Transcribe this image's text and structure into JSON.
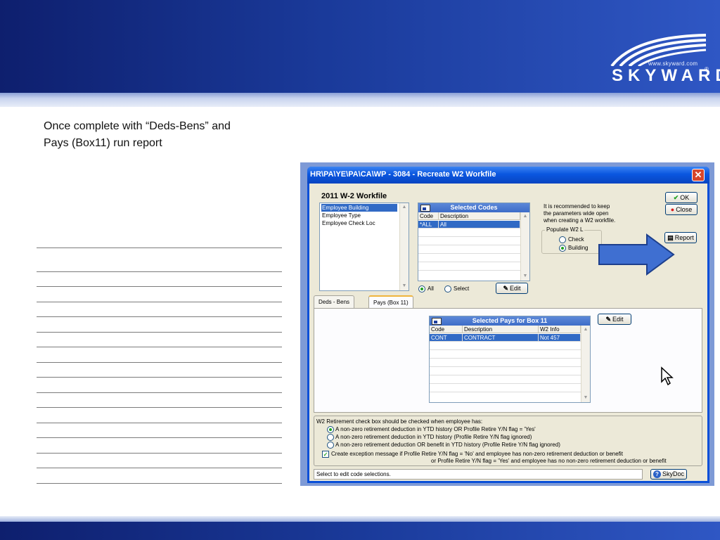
{
  "header": {
    "logo_url": "www.skyward.com",
    "logo_text": "SKYWARD",
    "logo_reg": "®"
  },
  "slide": {
    "text_line1": "Once complete with “Deds-Bens”  and",
    "text_line2": "Pays (Box11) run report"
  },
  "window": {
    "title": "HR\\PA\\YE\\PA\\CA\\WP - 3084 - Recreate W2 Workfile",
    "close_glyph": "✕",
    "workfile_title": "2011 W-2 Workfile",
    "list_items": [
      "Employee Building",
      "Employee Type",
      "Employee Check Loc"
    ],
    "selected_codes": {
      "header": "Selected Codes",
      "columns": [
        "Code",
        "Description"
      ],
      "rows": [
        [
          "*ALL",
          "All"
        ]
      ]
    },
    "radio_all": "All",
    "radio_select": "Select",
    "edit_label": "Edit",
    "note_line1": "It is recommended to keep",
    "note_line2": "the parameters wide open",
    "note_line3": "when creating a W2 workfile.",
    "populate_title": "Populate W2 L",
    "populate_check": "Check",
    "populate_building": "Building",
    "ok_label": "OK",
    "close_label": "Close",
    "report_label": "Report",
    "tabs": [
      "Deds - Bens",
      "Pays (Box 11)"
    ],
    "selected_pays": {
      "header": "Selected Pays for Box 11",
      "columns": [
        "Code",
        "Description",
        "W2 Info"
      ],
      "rows": [
        [
          "CONT",
          "CONTRACT",
          "Not 457"
        ]
      ]
    },
    "retirement_title": "W2 Retirement check box should be checked when employee has:",
    "retirement_options": [
      "A non-zero retirement deduction in YTD history OR Profile Retire Y/N flag = 'Yes'",
      "A non-zero retirement deduction in YTD history (Profile Retire Y/N flag ignored)",
      "A non-zero retirement deduction OR benefit in YTD history (Profile Retire Y/N flag ignored)"
    ],
    "exception_line1": "Create exception message  if Profile Retire Y/N flag = 'No'  and employee has non-zero retirement deduction or benefit",
    "exception_line2": "or Profile Retire Y/N flag = 'Yes' and employee has no non-zero retirement deduction or benefit",
    "status_text": "Select to edit code selections.",
    "skydoc_label": "SkyDoc"
  },
  "colors": {
    "header_dark": "#0e1f6e",
    "header_light": "#2f57c4",
    "titlebar": "#0a56e0",
    "selection": "#316ac5",
    "arrow": "#3f6fd1"
  }
}
